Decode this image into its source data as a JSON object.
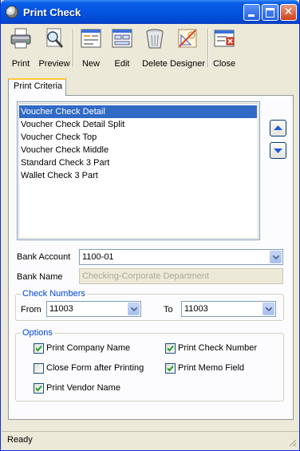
{
  "window": {
    "title": "Print Check"
  },
  "toolbar": {
    "print": "Print",
    "preview": "Preview",
    "new": "New",
    "edit": "Edit",
    "delete": "Delete",
    "designer": "Designer",
    "close": "Close"
  },
  "tabs": [
    {
      "label": "Print Criteria",
      "active": true
    }
  ],
  "report_list": {
    "items": [
      "Voucher Check Detail",
      "Voucher Check Detail Split",
      "Voucher Check Top",
      "Voucher Check Middle",
      "Standard Check 3 Part",
      "Wallet Check 3 Part"
    ],
    "selected": "Voucher Check Detail"
  },
  "bank": {
    "account_label": "Bank Account",
    "account_value": "1100-01",
    "name_label": "Bank Name",
    "name_value": "Checking-Corporate Department"
  },
  "check_numbers": {
    "legend": "Check Numbers",
    "from_label": "From",
    "from_value": "11003",
    "to_label": "To",
    "to_value": "11003"
  },
  "options": {
    "legend": "Options",
    "print_company_name": {
      "label": "Print Company Name",
      "checked": true
    },
    "print_check_number": {
      "label": "Print Check Number",
      "checked": true
    },
    "close_form_after_printing": {
      "label": "Close Form after Printing",
      "checked": false
    },
    "print_memo_field": {
      "label": "Print Memo Field",
      "checked": true
    },
    "print_vendor_name": {
      "label": "Print Vendor Name",
      "checked": true
    }
  },
  "status": {
    "text": "Ready"
  },
  "colors": {
    "title_blue": "#0454e0",
    "selection": "#316ac5",
    "group_legend": "#0046d5",
    "focus_tab": "#ffc83c"
  }
}
